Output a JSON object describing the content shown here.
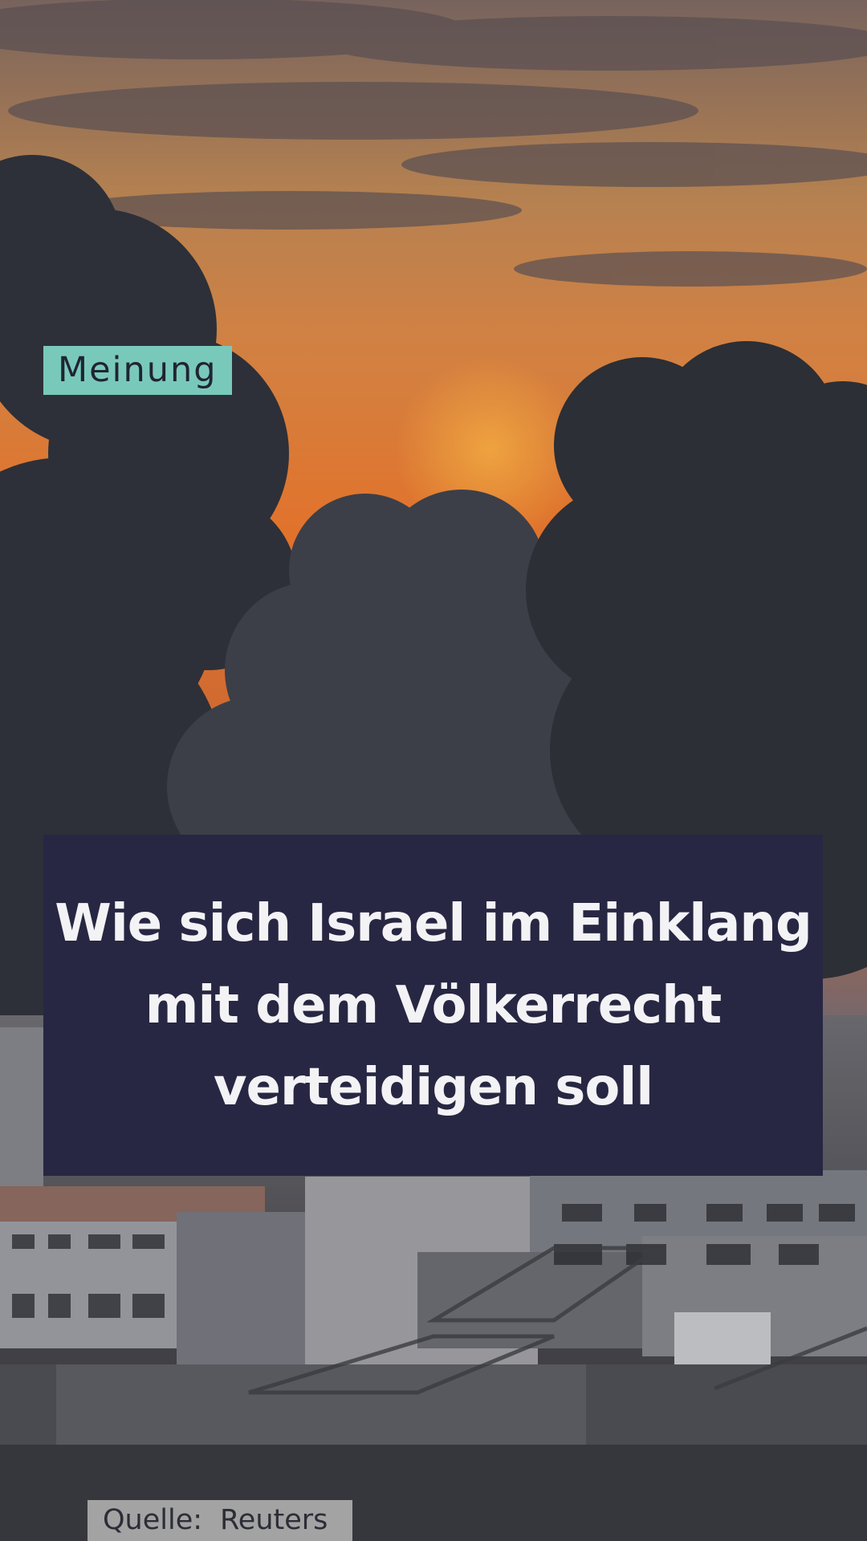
{
  "tag": {
    "label": "Meinung"
  },
  "headline": {
    "text": "Wie sich Israel im Einklang mit dem Völkerrecht verteidigen soll"
  },
  "credit": {
    "label": "Quelle:",
    "source": "Reuters"
  }
}
